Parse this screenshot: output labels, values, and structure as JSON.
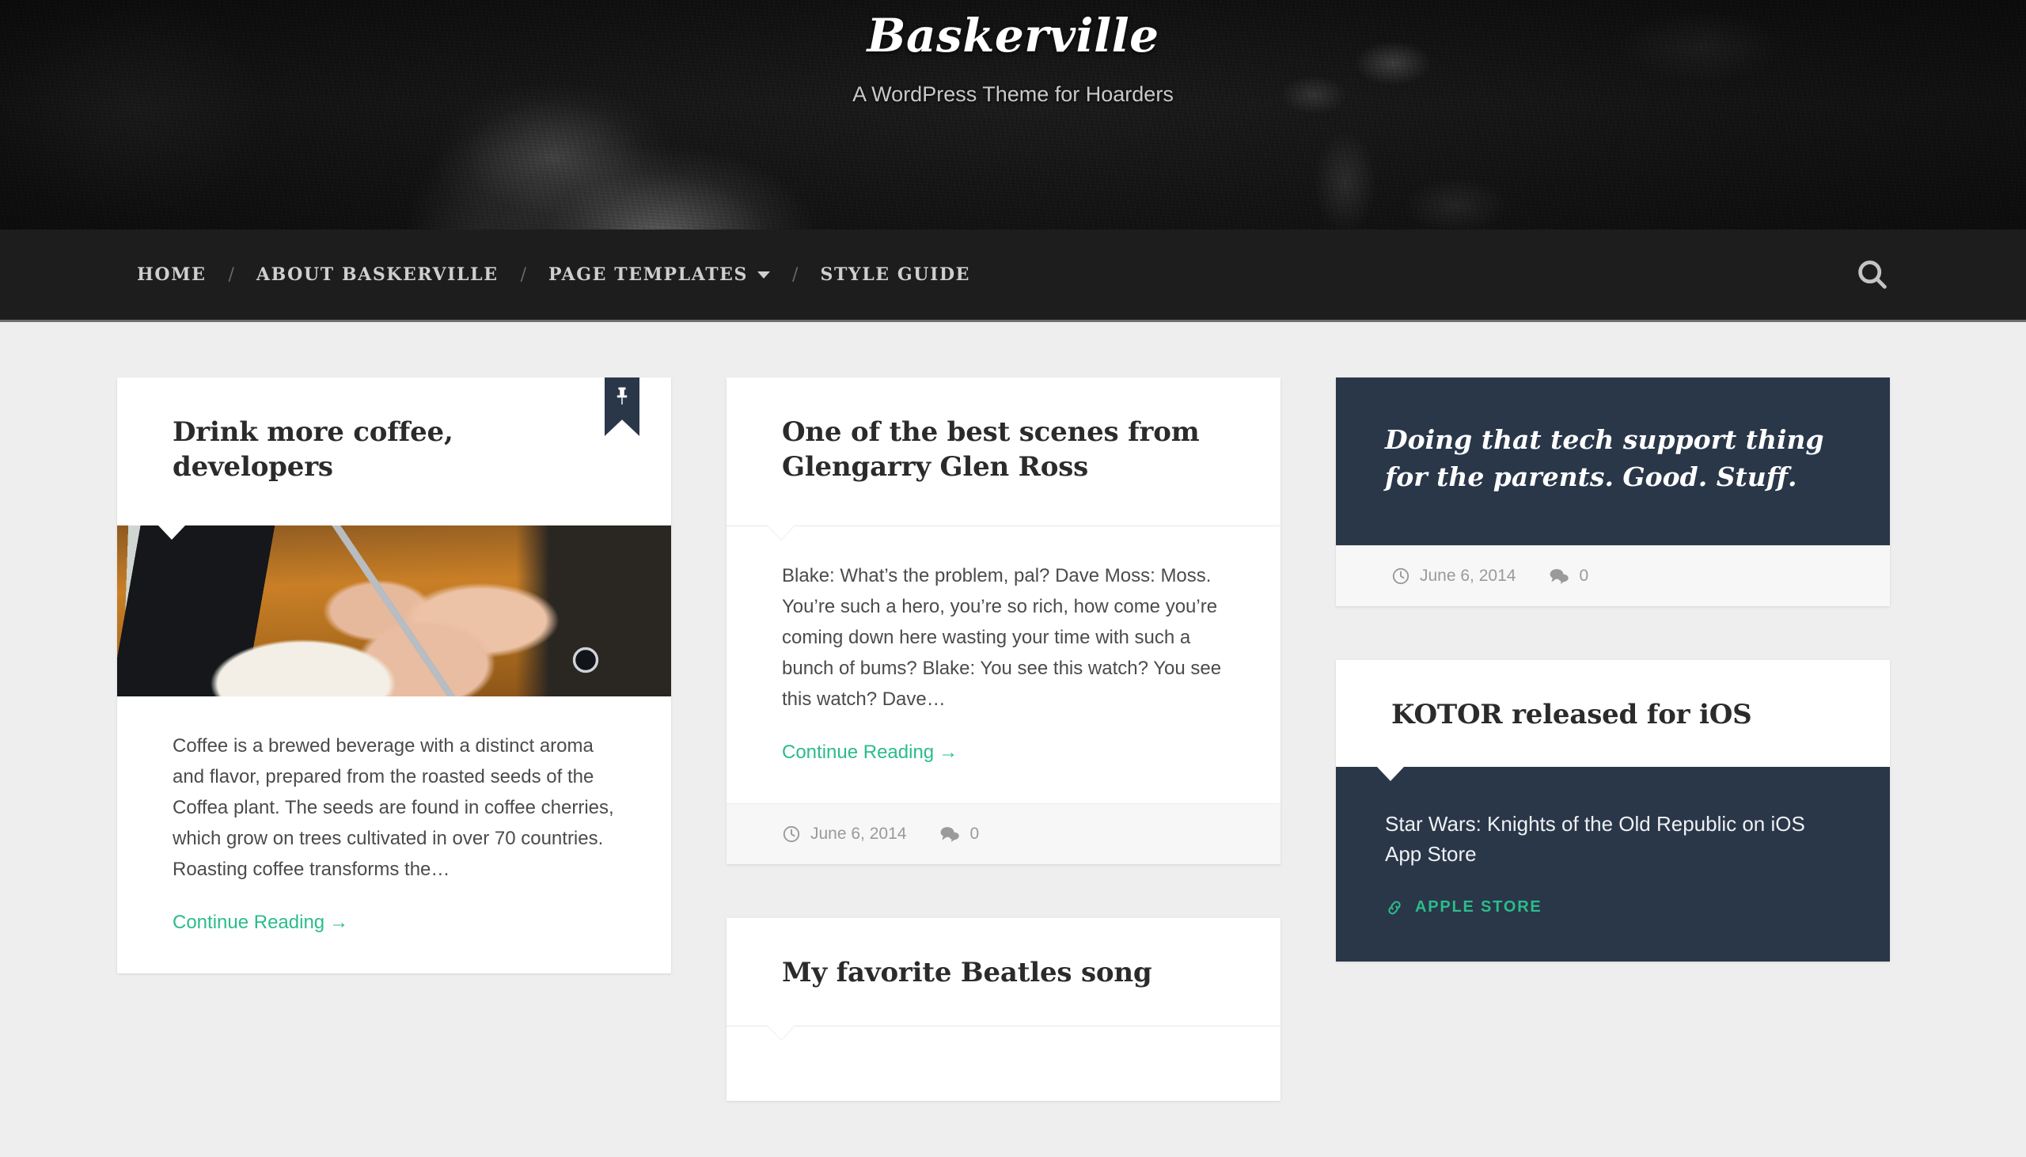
{
  "header": {
    "site_title": "Baskerville",
    "site_description": "A WordPress Theme for Hoarders"
  },
  "nav": {
    "items": [
      {
        "label": "HOME",
        "has_dropdown": false
      },
      {
        "label": "ABOUT BASKERVILLE",
        "has_dropdown": false
      },
      {
        "label": "PAGE TEMPLATES",
        "has_dropdown": true
      },
      {
        "label": "STYLE GUIDE",
        "has_dropdown": false
      }
    ],
    "separator": "/",
    "search_icon": "search-icon"
  },
  "posts": {
    "coffee": {
      "title": "Drink more coffee, developers",
      "sticky_icon": "pushpin-icon",
      "image_alt": "Hands writing in a notebook beside a laptop on a wooden desk",
      "summary": "Coffee is a brewed beverage with a distinct aroma and flavor, prepared from the roasted seeds of the Coffea plant. The seeds are found in coffee cherries, which grow on trees cultivated in over 70 countries. Roasting coffee transforms the…",
      "more_label": "Continue Reading",
      "more_arrow": "→"
    },
    "glengarry": {
      "title": "One of the best scenes from Glengarry Glen Ross",
      "summary": "Blake: What’s the problem, pal? Dave Moss: Moss. You’re such a hero, you’re so rich, how come you’re coming down here wasting your time with such a bunch of bums? Blake: You see this watch? You see this watch? Dave…",
      "more_label": "Continue Reading",
      "more_arrow": "→",
      "date": "June 6, 2014",
      "comments": "0"
    },
    "beatles": {
      "title": "My favorite Beatles song"
    },
    "quote": {
      "text": "Doing that tech support thing for the parents. Good. Stuff.",
      "date": "June 6, 2014",
      "comments": "0"
    },
    "kotor": {
      "title": "KOTOR released for iOS",
      "description": "Star Wars: Knights of the Old Republic on iOS App Store",
      "source_label": "APPLE STORE",
      "source_icon": "link-chain-icon"
    }
  },
  "icons": {
    "clock": "clock-icon",
    "comment": "comment-bubble-icon"
  },
  "colors": {
    "accent_green": "#2bbc8a",
    "dark_navy": "#2a3749",
    "page_background": "#eeeeee",
    "nav_background": "#1d1d1d",
    "meta_text": "#9a9a9a"
  }
}
